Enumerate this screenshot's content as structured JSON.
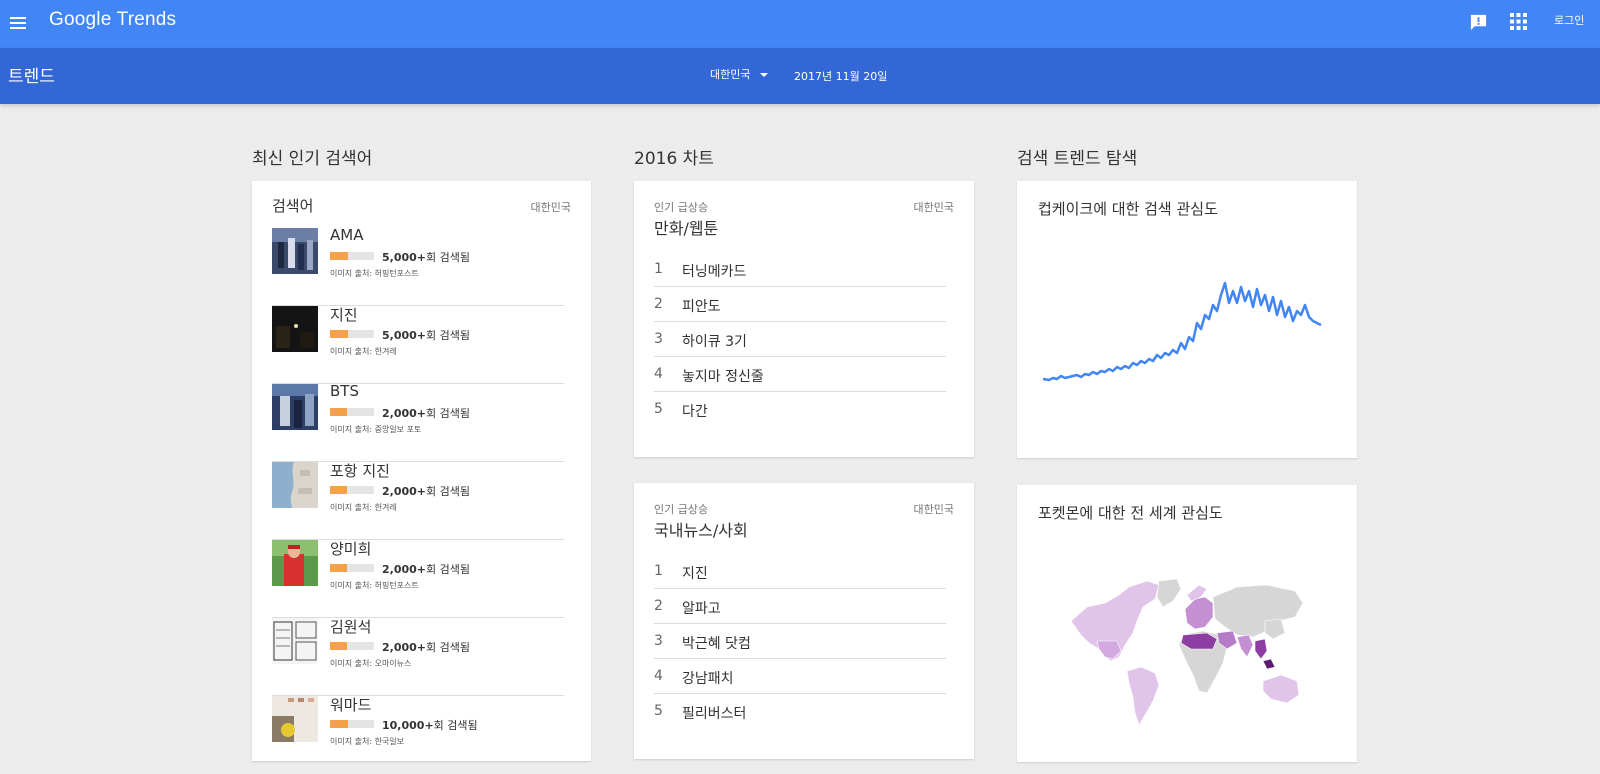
{
  "header": {
    "logo": "Google Trends",
    "login": "로그인"
  },
  "subheader": {
    "title": "트렌드",
    "region": "대한민국",
    "date": "2017년 11월 20일"
  },
  "sections": {
    "latest": "최신 인기 검색어",
    "chart2016": "2016 차트",
    "explore": "검색 트렌드 탐색"
  },
  "latest": {
    "head": "검색어",
    "region": "대한민국",
    "items": [
      {
        "term": "AMA",
        "count": "5,000+",
        "suffix": "회 검색됨",
        "source": "이미지 출처: 허핑턴포스트",
        "fill": 0.4
      },
      {
        "term": "지진",
        "count": "5,000+",
        "suffix": "회 검색됨",
        "source": "이미지 출처: 한겨레",
        "fill": 0.4
      },
      {
        "term": "BTS",
        "count": "2,000+",
        "suffix": "회 검색됨",
        "source": "이미지 출처: 중앙일보 포토",
        "fill": 0.38
      },
      {
        "term": "포항 지진",
        "count": "2,000+",
        "suffix": "회 검색됨",
        "source": "이미지 출처: 한겨레",
        "fill": 0.38
      },
      {
        "term": "양미희",
        "count": "2,000+",
        "suffix": "회 검색됨",
        "source": "이미지 출처: 허핑턴포스트",
        "fill": 0.38
      },
      {
        "term": "김원석",
        "count": "2,000+",
        "suffix": "회 검색됨",
        "source": "이미지 출처: 오마이뉴스",
        "fill": 0.38
      },
      {
        "term": "워마드",
        "count": "10,000+",
        "suffix": "회 검색됨",
        "source": "이미지 출처: 한국일보",
        "fill": 0.4
      }
    ]
  },
  "charts": [
    {
      "sub": "인기 급상승",
      "region": "대한민국",
      "category": "만화/웹툰",
      "items": [
        {
          "rank": "1",
          "term": "터닝메카드"
        },
        {
          "rank": "2",
          "term": "피안도"
        },
        {
          "rank": "3",
          "term": "하이큐 3기"
        },
        {
          "rank": "4",
          "term": "놓지마 정신줄"
        },
        {
          "rank": "5",
          "term": "다간"
        }
      ]
    },
    {
      "sub": "인기 급상승",
      "region": "대한민국",
      "category": "국내뉴스/사회",
      "items": [
        {
          "rank": "1",
          "term": "지진"
        },
        {
          "rank": "2",
          "term": "알파고"
        },
        {
          "rank": "3",
          "term": "박근혜 닷컴"
        },
        {
          "rank": "4",
          "term": "강남패치"
        },
        {
          "rank": "5",
          "term": "필리버스터"
        }
      ]
    }
  ],
  "explore": {
    "card1_title": "컵케이크에 대한 검색 관심도",
    "card2_title": "포켓몬에 대한 전 세계 관심도"
  },
  "colors": {
    "topbar": "#4285f4",
    "subbar": "#3367d6",
    "bar_fill": "#f5a14a",
    "line": "#4285f4",
    "map_light": "#e1c4ea",
    "map_mid": "#c58fd4",
    "map_dark": "#8e3ea3"
  }
}
